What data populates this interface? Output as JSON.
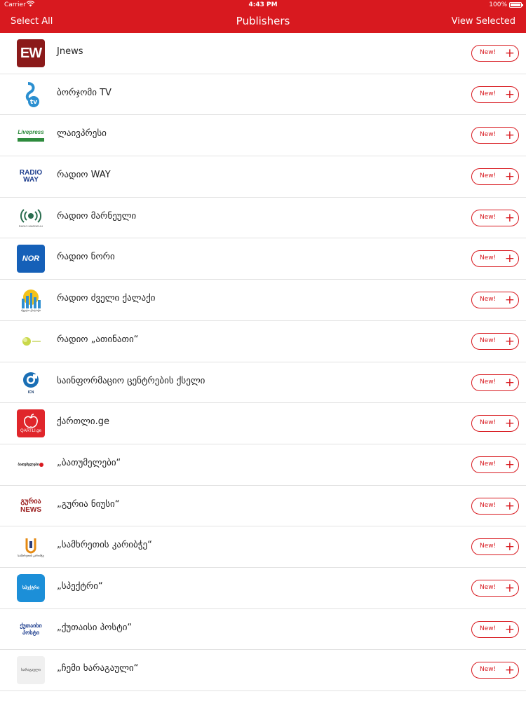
{
  "status_bar": {
    "carrier": "Carrier",
    "time": "4:43 PM",
    "battery": "100%"
  },
  "nav": {
    "left_button": "Select All",
    "title": "Publishers",
    "right_button": "View Selected"
  },
  "publishers": [
    {
      "name": "Jnews",
      "logo_text": "EW",
      "button_label": "New!"
    },
    {
      "name": "ბორჯომი TV",
      "logo_text": "tv",
      "button_label": "New!"
    },
    {
      "name": "ლაივპრესი",
      "logo_text": "Livepress",
      "button_label": "New!"
    },
    {
      "name": "რადიო WAY",
      "logo_text": "RADIO WAY",
      "button_label": "New!"
    },
    {
      "name": "რადიო მარნეული",
      "logo_text": "RADIO MARNEULI",
      "button_label": "New!"
    },
    {
      "name": "რადიო ნორი",
      "logo_text": "NOR",
      "button_label": "New!"
    },
    {
      "name": "რადიო ძველი ქალაქი",
      "logo_text": "ძველი ქალაქი",
      "button_label": "New!"
    },
    {
      "name": "რადიო „ათინათი“",
      "logo_text": "",
      "button_label": "New!"
    },
    {
      "name": "საინფორმაციო ცენტრების ქსელი",
      "logo_text": "ICN",
      "button_label": "New!"
    },
    {
      "name": "ქართლი.ge",
      "logo_text": "QARTLI.ge",
      "button_label": "New!"
    },
    {
      "name": "„ბათუმელები“",
      "logo_text": "ბათუმელები",
      "button_label": "New!"
    },
    {
      "name": "„გურია ნიუსი“",
      "logo_text": "გურია NEWS",
      "button_label": "New!"
    },
    {
      "name": "„სამხრეთის კარიბჭე“",
      "logo_text": "სამხრეთის კარიბჭე",
      "button_label": "New!"
    },
    {
      "name": "„სპექტრი“",
      "logo_text": "სპექტრი",
      "button_label": "New!"
    },
    {
      "name": "„ქუთაისი პოსტი“",
      "logo_text": "ქუთაისი პოსტი",
      "button_label": "New!"
    },
    {
      "name": "„ჩემი ხარაგაული“",
      "logo_text": "ხარაგაული",
      "button_label": "New!"
    }
  ],
  "colors": {
    "accent": "#d8191f",
    "separator": "#e2e2e2"
  }
}
